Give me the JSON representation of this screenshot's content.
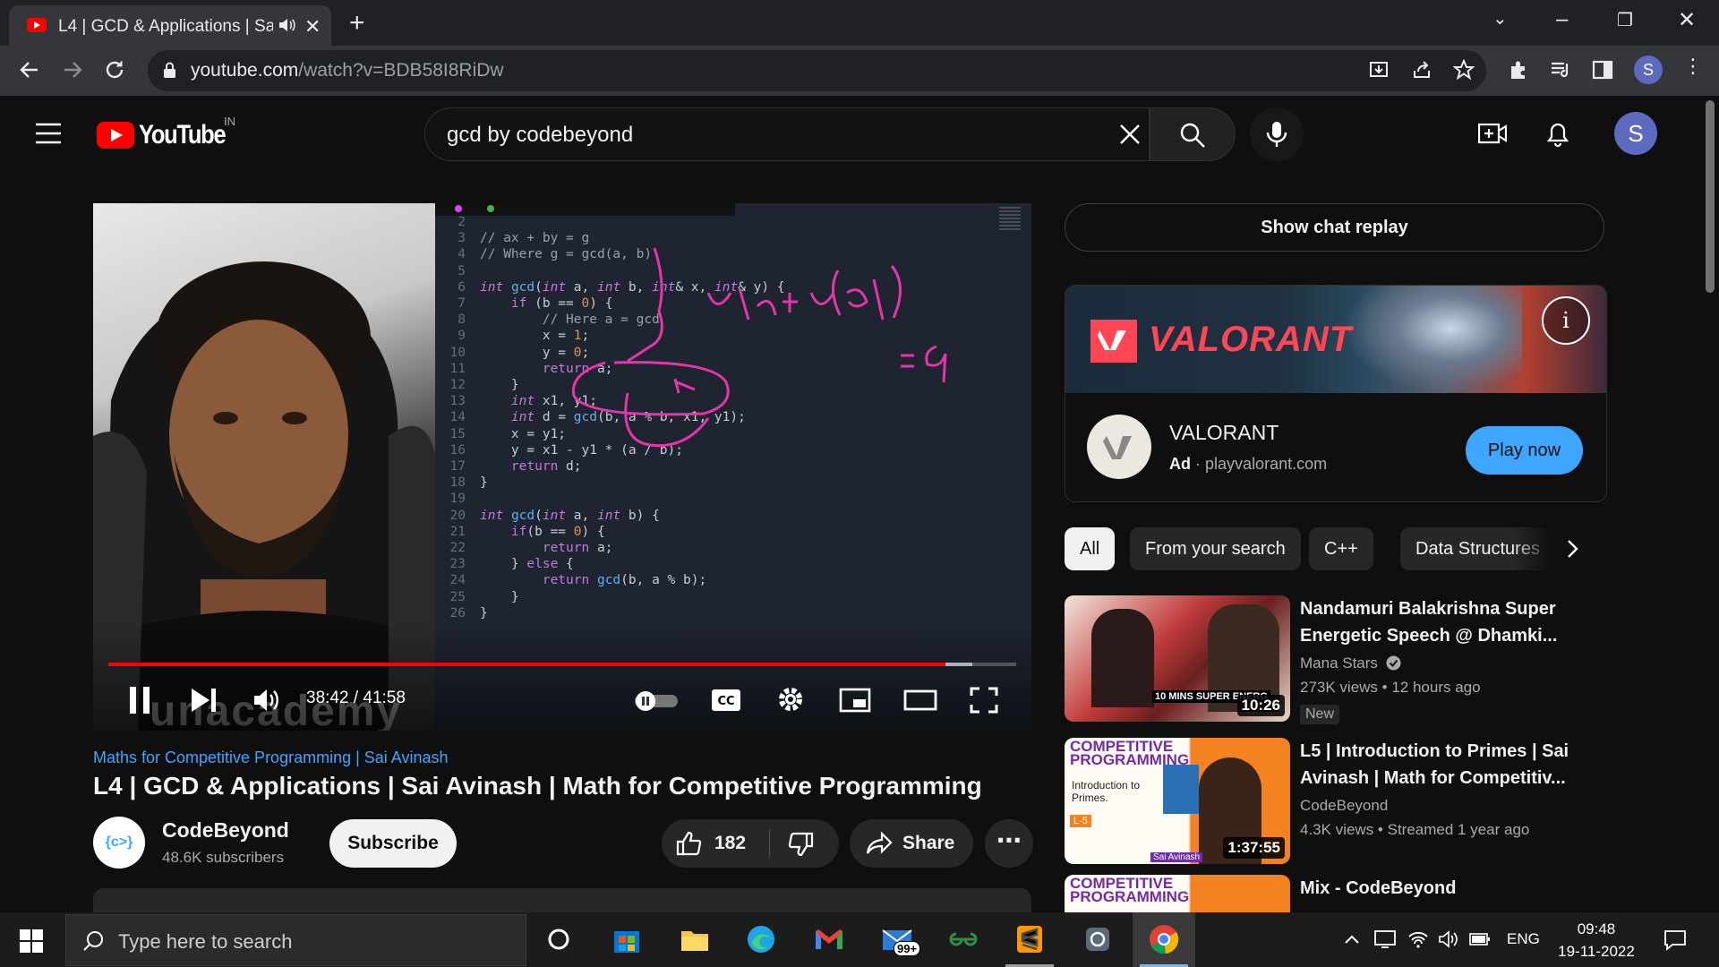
{
  "browser": {
    "tab_title": "L4 | GCD & Applications | Sai Avinash | Math for Competitive Programming",
    "url_host": "youtube.com",
    "url_path": "/watch?v=BDB58I8RiDw",
    "profile_initial": "S"
  },
  "header": {
    "logo_text": "YouTube",
    "country_code": "IN",
    "search_query": "gcd by codebeyond",
    "avatar_initial": "S"
  },
  "player": {
    "time_current": "38:42",
    "time_separator": "/",
    "time_total": "41:58",
    "progress_played_fraction": 0.922,
    "progress_loaded_fraction": 0.952,
    "code_lines": [
      {
        "n": "2",
        "code": ""
      },
      {
        "n": "3",
        "code": "// ax + by = g"
      },
      {
        "n": "4",
        "code": "// Where g = gcd(a, b)"
      },
      {
        "n": "5",
        "code": ""
      },
      {
        "n": "6",
        "code": "int gcd(int a, int b, int& x, int& y) {"
      },
      {
        "n": "7",
        "code": "    if (b == 0) {"
      },
      {
        "n": "8",
        "code": "        // Here a = gcd"
      },
      {
        "n": "9",
        "code": "        x = 1;"
      },
      {
        "n": "10",
        "code": "        y = 0;"
      },
      {
        "n": "11",
        "code": "        return a;"
      },
      {
        "n": "12",
        "code": "    }"
      },
      {
        "n": "13",
        "code": "    int x1, y1;"
      },
      {
        "n": "14",
        "code": "    int d = gcd(b, a % b, x1, y1);"
      },
      {
        "n": "15",
        "code": "    x = y1;"
      },
      {
        "n": "16",
        "code": "    y = x1 - y1 * (a / b);"
      },
      {
        "n": "17",
        "code": "    return d;"
      },
      {
        "n": "18",
        "code": "}"
      },
      {
        "n": "19",
        "code": ""
      },
      {
        "n": "20",
        "code": "int gcd(int a, int b) {"
      },
      {
        "n": "21",
        "code": "    if(b == 0) {"
      },
      {
        "n": "22",
        "code": "        return a;"
      },
      {
        "n": "23",
        "code": "    } else {"
      },
      {
        "n": "24",
        "code": "        return gcd(b, a % b);"
      },
      {
        "n": "25",
        "code": "    }"
      },
      {
        "n": "26",
        "code": "}"
      }
    ],
    "handwriting_line1": "x₁ b + y₁ (a%b)",
    "handwriting_line2": "= g",
    "watermark": "unacademy"
  },
  "video": {
    "playlist_link": "Maths for Competitive Programming | Sai Avinash",
    "title": "L4 | GCD & Applications | Sai Avinash | Math for Competitive Programming",
    "channel_name": "CodeBeyond",
    "channel_avatar_text": "{c>}",
    "subscribers": "48.6K subscribers",
    "subscribe_label": "Subscribe",
    "like_count": "182",
    "share_label": "Share",
    "more_label": "⋯"
  },
  "sidebar": {
    "chat_replay_label": "Show chat replay",
    "ad": {
      "banner_word": "VALORANT",
      "name": "VALORANT",
      "ad_label": "Ad",
      "dot": "·",
      "domain": "playvalorant.com",
      "cta_label": "Play now",
      "info_glyph": "i"
    },
    "chips": [
      "All",
      "From your search",
      "C++",
      "Data Structures"
    ],
    "recommendations": [
      {
        "title": "Nandamuri Balakrishna Super Energetic Speech @ Dhamki...",
        "channel": "Mana Stars",
        "verified": true,
        "views": "273K views",
        "age": "12 hours ago",
        "duration": "10:26",
        "badge": "New",
        "thumb_caption": "10 MINS SUPER ENERG"
      },
      {
        "title": "L5 | Introduction to Primes | Sai Avinash | Math for Competitiv...",
        "channel": "CodeBeyond",
        "verified": false,
        "views": "4.3K views",
        "age": "Streamed 1 year ago",
        "duration": "1:37:55",
        "thumb_heading": "COMPETITIVE PROGRAMMING",
        "thumb_sub": "Introduction to Primes.",
        "thumb_tag": "L-5",
        "thumb_name": "Sai Avinash"
      },
      {
        "title": "Mix - CodeBeyond",
        "thumb_heading": "COMPETITIVE PROGRAMMING"
      }
    ]
  },
  "taskbar": {
    "search_placeholder": "Type here to search",
    "mail_badge": "99+",
    "language": "ENG",
    "time": "09:48",
    "date": "19-11-2022"
  },
  "colors": {
    "youtube_red": "#ff0000",
    "link_blue": "#3ea6ff",
    "valorant_red": "#ff4655",
    "background": "#0f0f0f"
  }
}
